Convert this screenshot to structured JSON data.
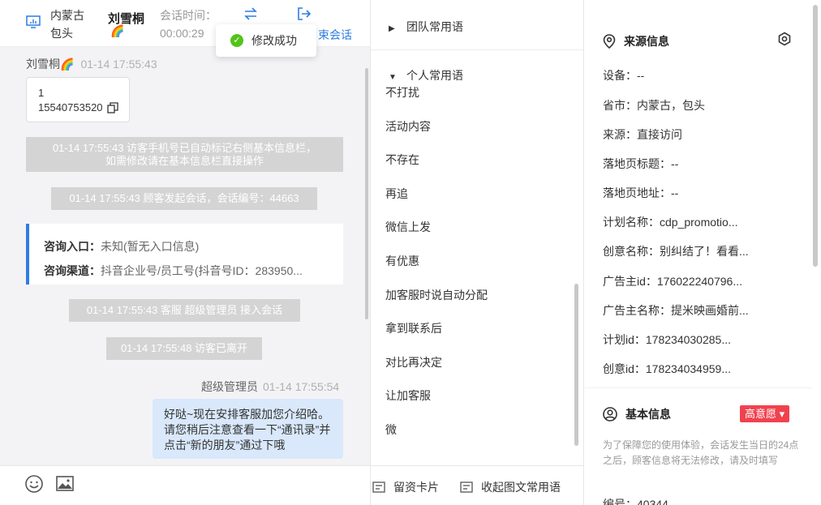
{
  "header": {
    "location_line1": "内蒙古",
    "location_line2": "包头",
    "visitor_name": "刘雪桐",
    "visitor_emoji": "🌈",
    "session_time_label": "会话时间：",
    "session_time_value": "00:00:29",
    "end_session_label": "束会话"
  },
  "toast": {
    "text": "修改成功"
  },
  "chat": {
    "visitor_msg": {
      "sender": "刘雪桐🌈",
      "time": "01-14 17:55:43",
      "line1": "1",
      "line2": "15540753520"
    },
    "system1": {
      "line1": "01-14 17:55:43 访客手机号已自动标记右侧基本信息栏，",
      "line2": "如需修改请在基本信息栏直接操作"
    },
    "system2": "01-14 17:55:43 顾客发起会话，会话编号：44663",
    "info_card": {
      "entry_label": "咨询入口：",
      "entry_value": "未知(暂无入口信息)",
      "channel_label": "咨询渠道：",
      "channel_value": "抖音企业号/员工号(抖音号ID：283950..."
    },
    "system3": "01-14 17:55:43 客服 超级管理员 接入会话",
    "system4": "01-14 17:55:48 访客已离开",
    "agent_msg": {
      "sender": "超级管理员",
      "time": "01-14 17:55:54",
      "text": "好哒~现在安排客服加您介绍哈。请您稍后注意查看一下“通讯录”并点击“新的朋友”通过下哦"
    }
  },
  "phrases": {
    "team_group": "团队常用语",
    "personal_group": "个人常用语",
    "items": [
      "不打扰",
      "活动内容",
      "不存在",
      "再追",
      "微信上发",
      "有优惠",
      "加客服时说自动分配",
      "拿到联系后",
      "对比再决定",
      "让加客服",
      "微"
    ],
    "card_button": "留资卡片",
    "collapse_button": "收起图文常用语"
  },
  "source_info": {
    "title": "来源信息",
    "fields": [
      "设备：--",
      "省市：内蒙古，包头",
      "来源：直接访问",
      "落地页标题：--",
      "落地页地址：--",
      "计划名称：cdp_promotio...",
      "创意名称：别纠结了！看看...",
      "广告主id：176022240796...",
      "广告主名称：提米映画婚前...",
      "计划id：178234030285...",
      "创意id：178234034959..."
    ]
  },
  "basic_info": {
    "title": "基本信息",
    "badge": "高意愿",
    "notice": "为了保障您的使用体验，会话发生当日的24点之后，顾客信息将无法修改，请及时填写",
    "id_field": "编号：40344"
  }
}
